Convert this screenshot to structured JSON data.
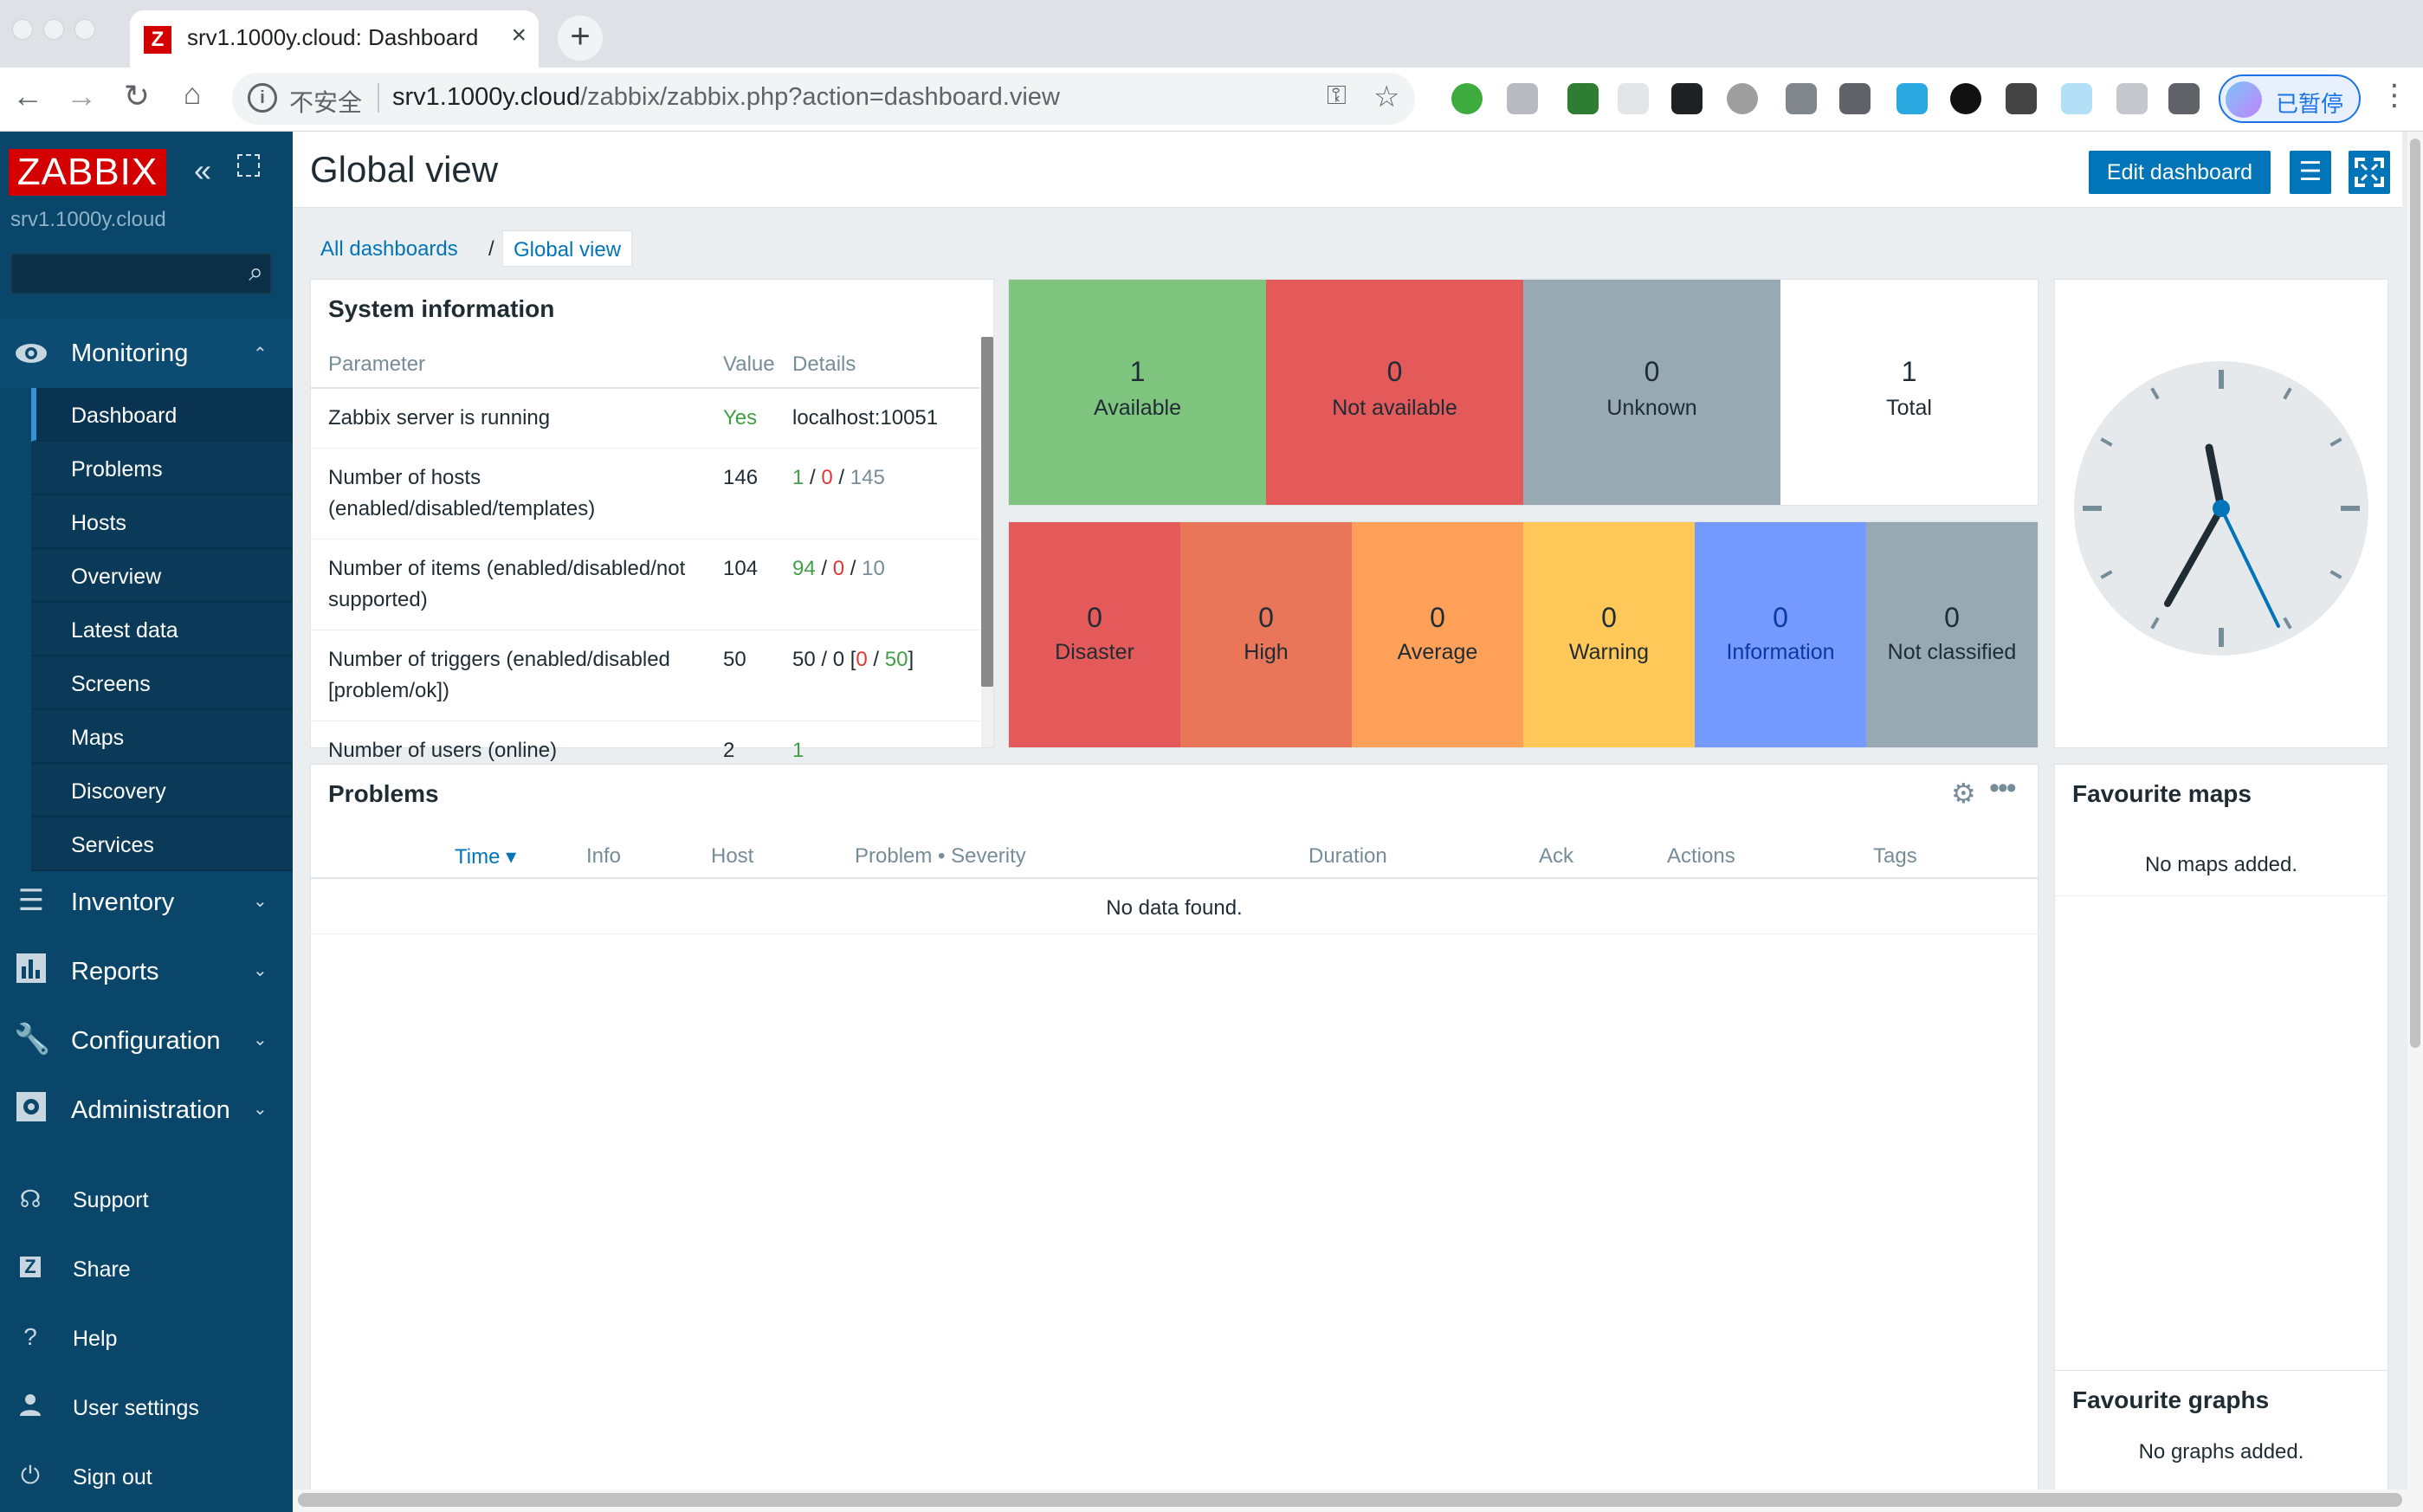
{
  "browser": {
    "tab_title": "srv1.1000y.cloud: Dashboard",
    "tab_favicon": "Z",
    "insecure_label": "不安全",
    "url_host": "srv1.1000y.cloud",
    "url_path": "/zabbix/zabbix.php?action=dashboard.view",
    "profile_label": "已暂停"
  },
  "sidebar": {
    "logo": "ZABBIX",
    "server_name": "srv1.1000y.cloud",
    "search_value": "",
    "monitoring": {
      "label": "Monitoring",
      "items": [
        "Dashboard",
        "Problems",
        "Hosts",
        "Overview",
        "Latest data",
        "Screens",
        "Maps",
        "Discovery",
        "Services"
      ]
    },
    "sections": [
      {
        "label": "Inventory",
        "icon": "list-icon"
      },
      {
        "label": "Reports",
        "icon": "bar-chart-icon"
      },
      {
        "label": "Configuration",
        "icon": "wrench-icon"
      },
      {
        "label": "Administration",
        "icon": "gear-icon"
      }
    ],
    "utilities": [
      {
        "label": "Support",
        "icon": "headset-icon"
      },
      {
        "label": "Share",
        "icon": "share-icon"
      },
      {
        "label": "Help",
        "icon": "help-icon"
      },
      {
        "label": "User settings",
        "icon": "user-icon"
      },
      {
        "label": "Sign out",
        "icon": "power-icon"
      }
    ]
  },
  "header": {
    "title": "Global view",
    "edit_button": "Edit dashboard"
  },
  "breadcrumb": {
    "all": "All dashboards",
    "separator": "/",
    "current": "Global view"
  },
  "system_info": {
    "title": "System information",
    "columns": [
      "Parameter",
      "Value",
      "Details"
    ],
    "rows": [
      {
        "parameter": "Zabbix server is running",
        "value": "Yes",
        "details": "localhost:10051"
      },
      {
        "parameter": "Number of hosts (enabled/disabled/templates)",
        "value": "146",
        "d1": "1",
        "d2": "0",
        "d3": "145",
        "sep": " / "
      },
      {
        "parameter": "Number of items (enabled/disabled/not supported)",
        "value": "104",
        "d1": "94",
        "d2": "0",
        "d3": "10",
        "sep": " / "
      },
      {
        "parameter": "Number of triggers (enabled/disabled [problem/ok])",
        "value": "50",
        "prefix": "50 / 0 [",
        "d1": "0",
        "d2": "50",
        "suffix": "]",
        "sep": " / "
      },
      {
        "parameter": "Number of users (online)",
        "value": "2",
        "details": "1"
      }
    ]
  },
  "host_availability": [
    {
      "count": "1",
      "label": "Available",
      "color": "#7fc57f"
    },
    {
      "count": "0",
      "label": "Not available",
      "color": "#e45959"
    },
    {
      "count": "0",
      "label": "Unknown",
      "color": "#97aab3"
    },
    {
      "count": "1",
      "label": "Total",
      "color": "#ffffff"
    }
  ],
  "severity": [
    {
      "count": "0",
      "label": "Disaster",
      "color": "#e45959"
    },
    {
      "count": "0",
      "label": "High",
      "color": "#e97659"
    },
    {
      "count": "0",
      "label": "Average",
      "color": "#ffa059"
    },
    {
      "count": "0",
      "label": "Warning",
      "color": "#ffc859"
    },
    {
      "count": "0",
      "label": "Information",
      "color": "#7499ff"
    },
    {
      "count": "0",
      "label": "Not classified",
      "color": "#97aab3"
    }
  ],
  "problems": {
    "title": "Problems",
    "columns": [
      "Time ▾",
      "Info",
      "Host",
      "Problem • Severity",
      "Duration",
      "Ack",
      "Actions",
      "Tags"
    ],
    "empty": "No data found."
  },
  "favourite_maps": {
    "title": "Favourite maps",
    "empty": "No maps added."
  },
  "favourite_graphs": {
    "title": "Favourite graphs",
    "empty": "No graphs added."
  },
  "colors": {
    "brand": "#d40000",
    "sidebar": "#0a466a",
    "accent": "#0275b8"
  }
}
